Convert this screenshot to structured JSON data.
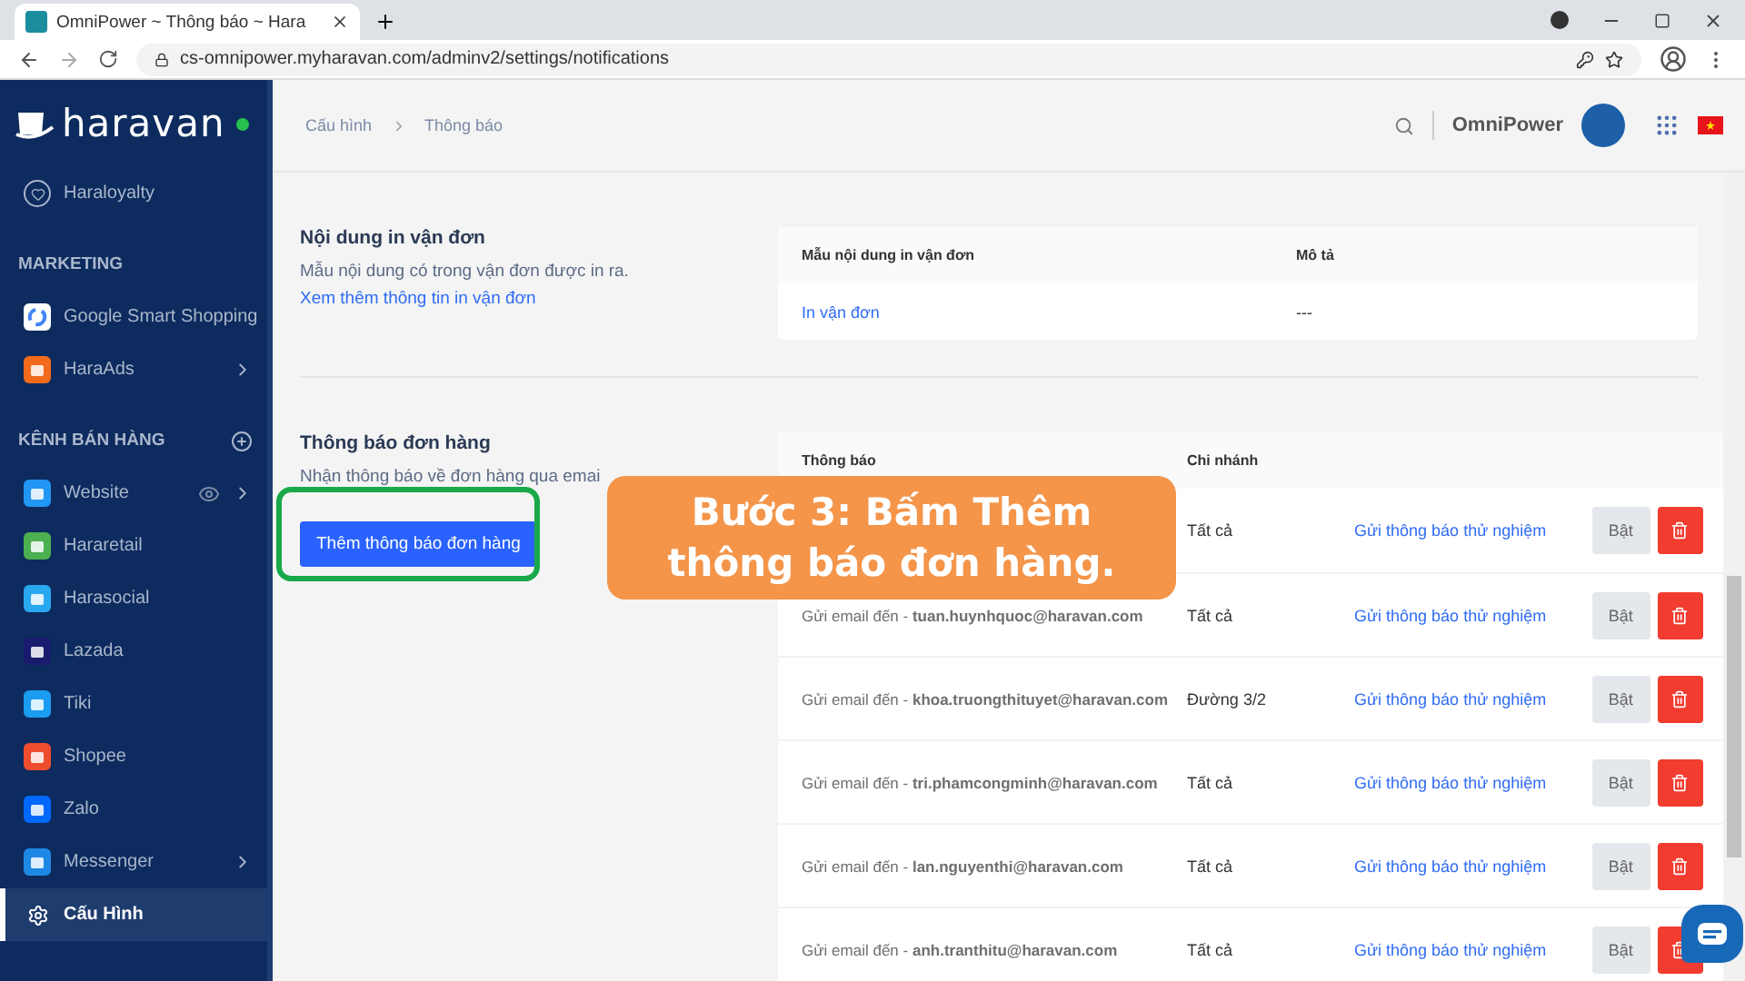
{
  "browser": {
    "tab_title": "OmniPower ~ Thông báo ~ Hara",
    "url": "cs-omnipower.myharavan.com/adminv2/settings/notifications"
  },
  "sidebar": {
    "logo": "haravan",
    "online": true,
    "items": [
      {
        "kind": "item",
        "label": "Haraloyalty",
        "selected": false
      },
      {
        "kind": "heading",
        "label": "MARKETING",
        "add": false
      },
      {
        "kind": "item",
        "label": "Google Smart Shopping",
        "color": "#ffffff",
        "selected": false
      },
      {
        "kind": "item",
        "label": "HaraAds",
        "color": "#f26b1d",
        "chevron": true,
        "selected": false
      },
      {
        "kind": "heading",
        "label": "KÊNH BÁN HÀNG",
        "add": true
      },
      {
        "kind": "item",
        "label": "Website",
        "color": "#2196f3",
        "chevron": true,
        "eye": true,
        "selected": false
      },
      {
        "kind": "item",
        "label": "Hararetail",
        "color": "#4caf50",
        "selected": false
      },
      {
        "kind": "item",
        "label": "Harasocial",
        "color": "#29a8f0",
        "selected": false
      },
      {
        "kind": "item",
        "label": "Lazada",
        "color": "#1a1a6e",
        "selected": false
      },
      {
        "kind": "item",
        "label": "Tiki",
        "color": "#1a9cf0",
        "selected": false
      },
      {
        "kind": "item",
        "label": "Shopee",
        "color": "#ee4d2d",
        "selected": false
      },
      {
        "kind": "item",
        "label": "Zalo",
        "color": "#0068ff",
        "selected": false
      },
      {
        "kind": "item",
        "label": "Messenger",
        "color": "#1e88e5",
        "chevron": true,
        "selected": false
      },
      {
        "kind": "item",
        "label": "Cấu Hình",
        "selected": true
      }
    ]
  },
  "header": {
    "breadcrumb": [
      "Cấu hình",
      "Thông báo"
    ],
    "account": "OmniPower"
  },
  "print_section": {
    "title": "Nội dung in vận đơn",
    "description": "Mẫu nội dung có trong vận đơn được in ra.",
    "link": "Xem thêm thông tin in vận đơn",
    "columns": [
      "Mẫu nội dung in vận đơn",
      "Mô tả"
    ],
    "rows": [
      {
        "template": "In vận đơn",
        "description": "---"
      }
    ]
  },
  "notify_section": {
    "title": "Thông báo đơn hàng",
    "description": "Nhận thông báo về đơn hàng qua emai",
    "add_button": "Thêm thông báo đơn hàng",
    "highlighted": true,
    "columns": [
      "Thông báo",
      "Chi nhánh"
    ],
    "rows": [
      {
        "notify": "",
        "branch": "Tất cả",
        "test": "Gửi thông báo thử nghiệm",
        "toggle": "Bật",
        "disabled": true
      },
      {
        "notify": "Gửi email đến - **tuan.huynhquoc@haravan.com**",
        "branch": "Tất cả",
        "test": "Gửi thông báo thử nghiệm",
        "toggle": "Bật",
        "disabled": true
      },
      {
        "notify": "Gửi email đến - **khoa.truongthituyet@haravan.com**",
        "branch": "Đường 3/2",
        "test": "Gửi thông báo thử nghiệm",
        "toggle": "Bật",
        "disabled": true
      },
      {
        "notify": "Gửi email đến - **tri.phamcongminh@haravan.com**",
        "branch": "Tất cả",
        "test": "Gửi thông báo thử nghiệm",
        "toggle": "Bật",
        "disabled": true
      },
      {
        "notify": "Gửi email đến - **lan.nguyenthi@haravan.com**",
        "branch": "Tất cả",
        "test": "Gửi thông báo thử nghiệm",
        "toggle": "Bật",
        "disabled": true
      },
      {
        "notify": "Gửi email đến - **anh.tranthitu@haravan.com**",
        "branch": "Tất cả",
        "test": "Gửi thông báo thử nghiệm",
        "toggle": "Bật",
        "disabled": true
      }
    ]
  },
  "callout": {
    "text": "Bước 3: Bấm Thêm thông báo đơn hàng."
  }
}
